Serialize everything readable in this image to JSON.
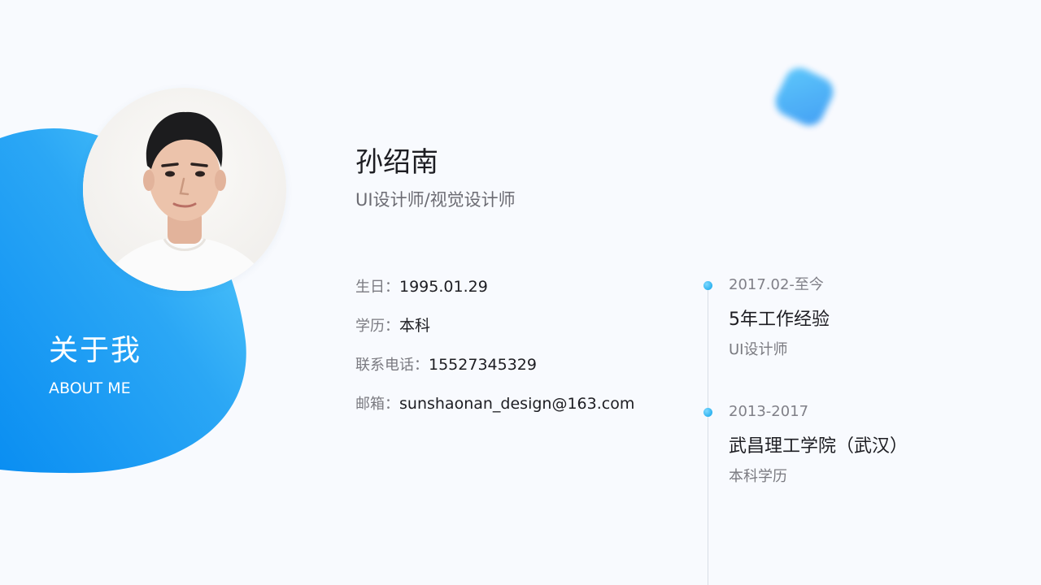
{
  "about": {
    "title": "关于我",
    "subtitle": "ABOUT ME"
  },
  "profile": {
    "name": "孙绍南",
    "job_title": "UI设计师/视觉设计师"
  },
  "info": [
    {
      "label": "生日：",
      "value": "1995.01.29"
    },
    {
      "label": "学历：",
      "value": "本科"
    },
    {
      "label": "联系电话：",
      "value": "15527345329"
    },
    {
      "label": "邮箱：",
      "value": "sunshaonan_design@163.com"
    }
  ],
  "timeline": [
    {
      "date": "2017.02-至今",
      "title": "5年工作经验",
      "desc": "UI设计师"
    },
    {
      "date": "2013-2017",
      "title": "武昌理工学院（武汉）",
      "desc": "本科学历"
    }
  ],
  "colors": {
    "accent_start": "#0a8ef2",
    "accent_end": "#4cc6fb",
    "background": "#f8fafe"
  },
  "icons": {
    "avatar": "portrait-photo",
    "decoration": "rounded-square-blur",
    "timeline_marker": "dot"
  }
}
